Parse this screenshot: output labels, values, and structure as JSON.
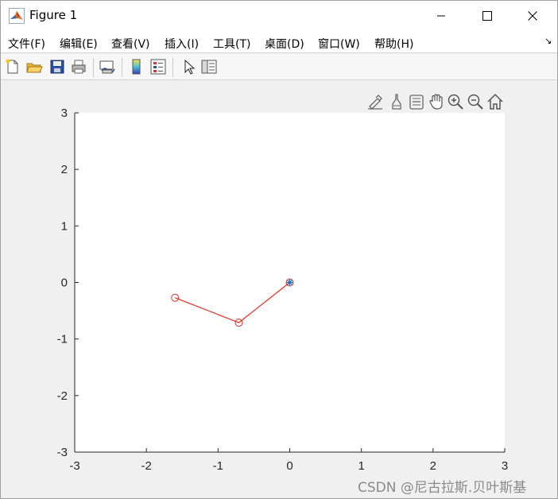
{
  "window": {
    "title": "Figure 1",
    "controls": {
      "minimize": "minimize",
      "maximize": "maximize",
      "close": "close"
    }
  },
  "menubar": {
    "items": [
      {
        "label": "文件(F)"
      },
      {
        "label": "编辑(E)"
      },
      {
        "label": "查看(V)"
      },
      {
        "label": "插入(I)"
      },
      {
        "label": "工具(T)"
      },
      {
        "label": "桌面(D)"
      },
      {
        "label": "窗口(W)"
      },
      {
        "label": "帮助(H)"
      }
    ],
    "dock_arrow": "↘"
  },
  "toolbar": {
    "buttons": [
      "new-figure-icon",
      "open-icon",
      "save-icon",
      "print-icon",
      "link-plot-icon",
      "colorbar-icon",
      "legend-icon",
      "pointer-icon",
      "property-inspector-icon"
    ]
  },
  "axes_toolbar": {
    "buttons": [
      "brush-edit-icon",
      "data-tips-icon",
      "brush-icon",
      "pan-icon",
      "zoom-in-icon",
      "zoom-out-icon",
      "home-icon"
    ]
  },
  "chart_data": {
    "type": "line",
    "title": "",
    "xlabel": "",
    "ylabel": "",
    "xlim": [
      -3,
      3
    ],
    "ylim": [
      -3,
      3
    ],
    "xticks": [
      "-3",
      "-2",
      "-1",
      "0",
      "1",
      "2",
      "3"
    ],
    "yticks": [
      "3",
      "2",
      "1",
      "0",
      "-1",
      "-2",
      "-3"
    ],
    "grid": false,
    "series": [
      {
        "marker": "o",
        "color": "#e03020",
        "points": [
          [
            -1.6,
            -0.27
          ],
          [
            -0.71,
            -0.71
          ],
          [
            0,
            0
          ]
        ]
      },
      {
        "marker": "*",
        "color": "#1f6fb4",
        "points": [
          [
            0,
            0
          ]
        ]
      }
    ]
  },
  "watermark": "CSDN @尼古拉斯.贝叶斯基",
  "colors": {
    "line": "#e03020",
    "marker_star": "#1f6fb4",
    "axes_bg": "#ffffff",
    "figure_bg": "#f0f0f0"
  }
}
